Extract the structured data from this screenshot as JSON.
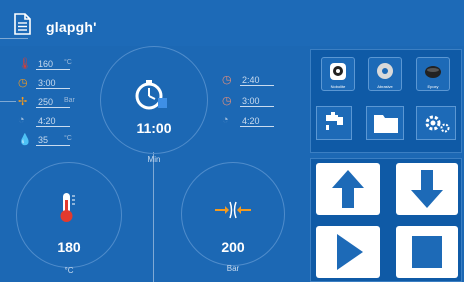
{
  "header": {
    "title": "glapgh'",
    "icon": "document-icon"
  },
  "left_params": [
    {
      "icon": "thermometer-icon",
      "value": "160",
      "unit": "°C"
    },
    {
      "icon": "clock-icon",
      "value": "3:00",
      "unit": ""
    },
    {
      "icon": "fan-icon",
      "value": "250",
      "unit": "Bar"
    },
    {
      "icon": "timer-icon",
      "value": "4:20",
      "unit": ""
    },
    {
      "icon": "drop-icon",
      "value": "35",
      "unit": "°C"
    }
  ],
  "right_params": [
    {
      "icon": "clock-icon",
      "value": "2:40"
    },
    {
      "icon": "clock-icon",
      "value": "3:00"
    },
    {
      "icon": "timer-icon",
      "value": "4:20"
    }
  ],
  "timer_gauge": {
    "value": "11:00",
    "unit": "Min"
  },
  "temperature_gauge": {
    "value": "180",
    "unit": "°C"
  },
  "pressure_gauge": {
    "value": "200",
    "unit": "Bar"
  },
  "tool_buttons": [
    {
      "label": "Nobolite",
      "icon": "bottle-icon"
    },
    {
      "label": "Abrasive",
      "icon": "disc-icon"
    },
    {
      "label": "Epoxy",
      "icon": "pot-icon"
    }
  ],
  "action_buttons": [
    "faucet-icon",
    "folder-icon",
    "settings-icon"
  ],
  "control_buttons": [
    "up-arrow-icon",
    "down-arrow-icon",
    "play-icon",
    "stop-icon"
  ],
  "colors": {
    "background": "#1c68b4",
    "panel": "#0f5aa6",
    "button": "#ffffff",
    "accent_red": "#e23a2e",
    "accent_orange": "#f39a1e"
  }
}
